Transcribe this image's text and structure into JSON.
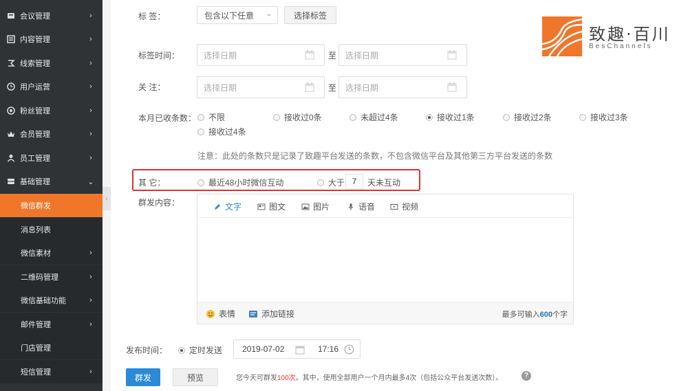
{
  "sidebar": {
    "items": [
      {
        "label": "会议管理",
        "icon": "meeting-icon",
        "chevron": "›"
      },
      {
        "label": "内容管理",
        "icon": "content-icon",
        "chevron": "›"
      },
      {
        "label": "线索管理",
        "icon": "leads-icon",
        "chevron": "›"
      },
      {
        "label": "用户运营",
        "icon": "user-ops-icon",
        "chevron": "›"
      },
      {
        "label": "粉丝管理",
        "icon": "fans-icon",
        "chevron": "›"
      },
      {
        "label": "会员管理",
        "icon": "member-icon",
        "chevron": "›"
      },
      {
        "label": "员工管理",
        "icon": "staff-icon",
        "chevron": "›"
      },
      {
        "label": "基础管理",
        "icon": "base-icon",
        "chevron": "⌄"
      }
    ],
    "subitems": [
      {
        "label": "微信群发",
        "chevron": ""
      },
      {
        "label": "消息列表",
        "chevron": ""
      },
      {
        "label": "微信素材",
        "chevron": "›"
      },
      {
        "label": "二维码管理",
        "chevron": "›"
      },
      {
        "label": "微信基础功能",
        "chevron": "›"
      },
      {
        "label": "邮件管理",
        "chevron": "›"
      },
      {
        "label": "门店管理",
        "chevron": ""
      },
      {
        "label": "短信管理",
        "chevron": "›"
      }
    ],
    "collapse": "‹",
    "accent": "#f0762a"
  },
  "logo": {
    "name": "致趣·百川",
    "sub": "BesChannels"
  },
  "form": {
    "tag": {
      "label": "标  签：",
      "select": "包含以下任意",
      "button": "选择标签"
    },
    "tag_time": {
      "label": "标签时间：",
      "start": "选择日期",
      "sep": "至",
      "end": "选择日期"
    },
    "follow": {
      "label": "关  注：",
      "start": "选择日期",
      "sep": "至",
      "end": "选择日期"
    },
    "monthly": {
      "label": "本月已收条数：",
      "options": [
        "不限",
        "接收过0条",
        "未超过4条",
        "接收过1条",
        "接收过2条",
        "接收过3条",
        "接收过4条"
      ],
      "selected": "接收过1条",
      "note": "注意：此处的条数只是记录了致趣平台发送的条数，不包含微信平台及其他第三方平台发送的条数"
    },
    "other": {
      "label": "其  它：",
      "option1": "最近48小时微信互动",
      "option2_prefix": "大于",
      "option2_days": "7",
      "option2_suffix": "天未互动"
    },
    "content": {
      "label": "群发内容：",
      "tabs": [
        "文字",
        "图文",
        "图片",
        "语音",
        "视频"
      ],
      "active_tab": "文字",
      "emoji": "表情",
      "link": "添加链接",
      "counter_prefix": "最多可输入",
      "counter_num": "600",
      "counter_suffix": "个字"
    },
    "publish": {
      "label": "发布时间：",
      "mode": "定时发送",
      "date": "2019-07-02",
      "time": "17:16"
    },
    "actions": {
      "send": "群发",
      "preview": "预览",
      "info_prefix": "您今天可群发",
      "info_count": "100次",
      "info_suffix": "。其中，使用全部用户一个月内最多4次（包括公众平台发送次数）。",
      "help": "?"
    }
  }
}
